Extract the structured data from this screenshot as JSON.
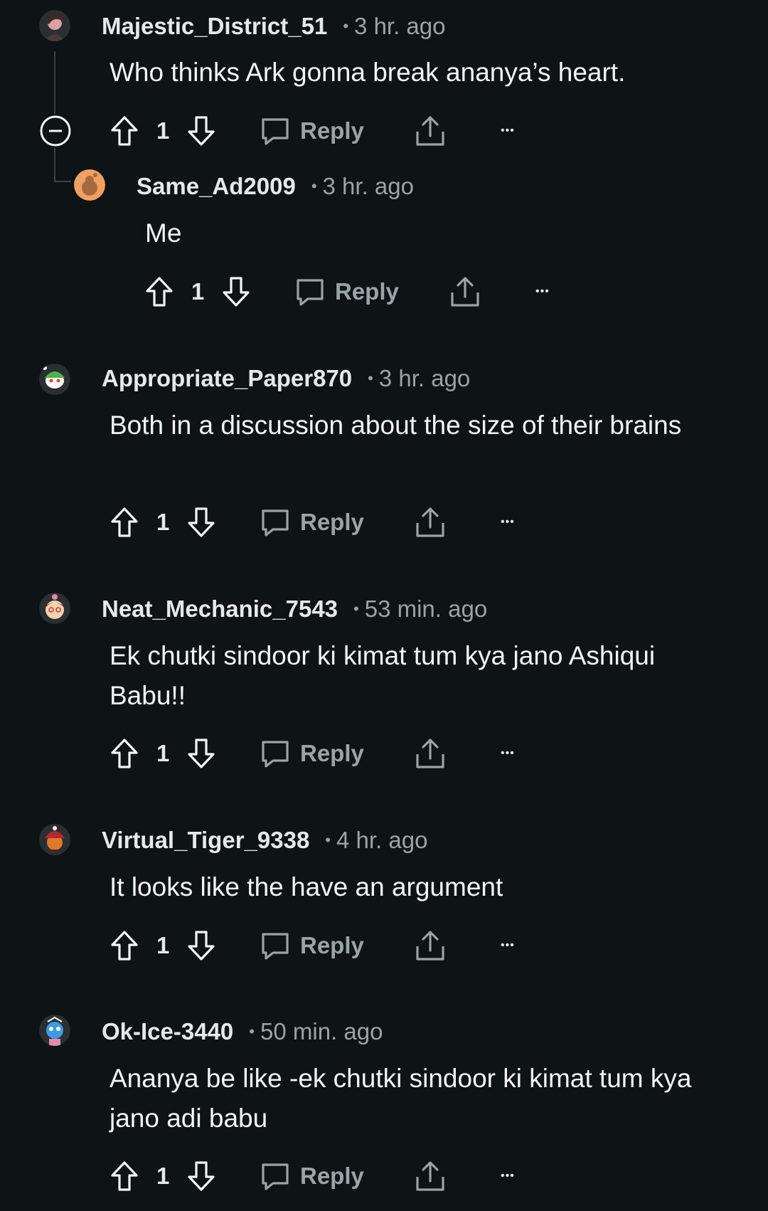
{
  "comments": [
    {
      "username": "Majestic_District_51",
      "dot": "•",
      "time": "3 hr. ago",
      "body": "Who thinks Ark gonna break ananya’s heart.",
      "votes": "1",
      "reply_label": "Reply",
      "avatar_color": "#d9a4a0",
      "more": "•••"
    },
    {
      "username": "Same_Ad2009",
      "dot": "•",
      "time": "3 hr. ago",
      "body": "Me",
      "votes": "1",
      "reply_label": "Reply",
      "avatar_color": "#f2a061",
      "more": "•••"
    },
    {
      "username": "Appropriate_Paper870",
      "dot": "•",
      "time": "3 hr. ago",
      "body": "Both in a discussion about the size of their brains",
      "votes": "1",
      "reply_label": "Reply",
      "avatar_color": "#4fb24a",
      "more": "•••"
    },
    {
      "username": "Neat_Mechanic_7543",
      "dot": "•",
      "time": "53 min. ago",
      "body": "Ek chutki sindoor ki kimat tum kya jano Ashiqui Babu!!",
      "votes": "1",
      "reply_label": "Reply",
      "avatar_color": "#e58aa6",
      "more": "•••"
    },
    {
      "username": "Virtual_Tiger_9338",
      "dot": "•",
      "time": "4 hr. ago",
      "body": "It looks like the have an argument",
      "votes": "1",
      "reply_label": "Reply",
      "avatar_color": "#b3292e",
      "more": "•••"
    },
    {
      "username": "Ok-Ice-3440",
      "dot": "•",
      "time": "50 min. ago",
      "body": "Ananya be like -ek chutki sindoor ki kimat tum kya jano adi babu",
      "votes": "1",
      "reply_label": "Reply",
      "avatar_color": "#3e9be0",
      "more": "•••"
    }
  ],
  "collapse_icon": "collapse-minus-icon"
}
